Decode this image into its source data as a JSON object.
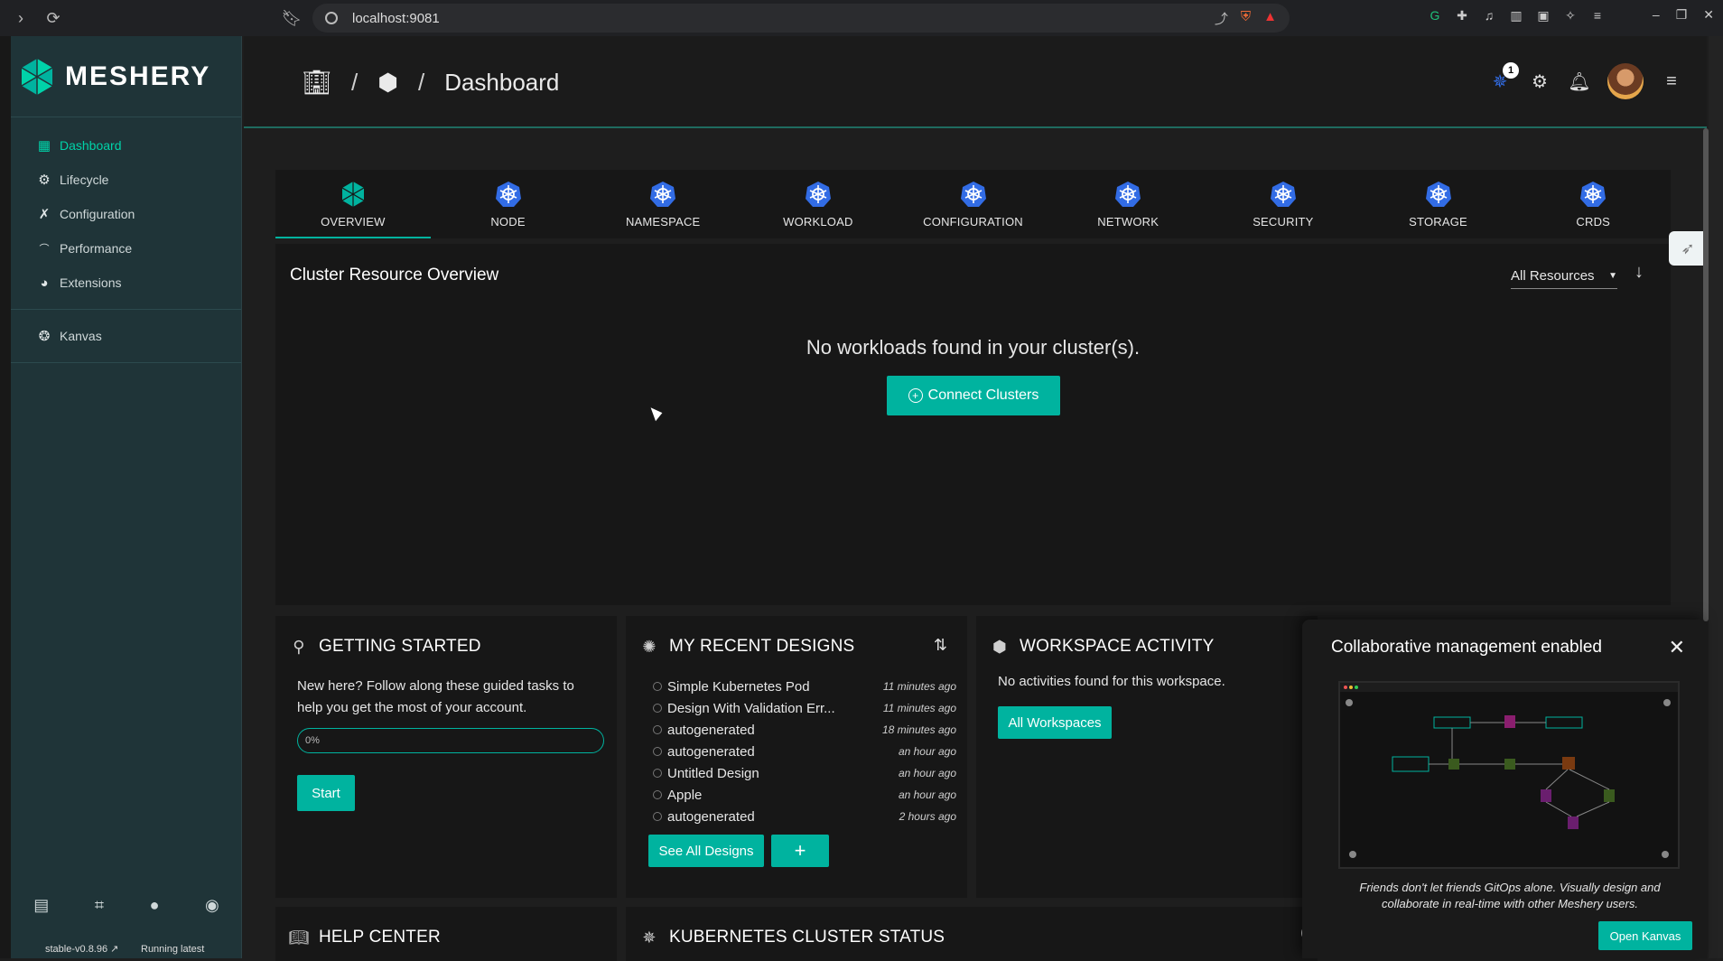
{
  "browser": {
    "url": "localhost:9081"
  },
  "brand": {
    "name": "MESHERY"
  },
  "sidebar": {
    "items": [
      {
        "label": "Dashboard",
        "icon": "dashboard-icon"
      },
      {
        "label": "Lifecycle",
        "icon": "lifecycle-icon"
      },
      {
        "label": "Configuration",
        "icon": "configuration-icon"
      },
      {
        "label": "Performance",
        "icon": "performance-icon"
      },
      {
        "label": "Extensions",
        "icon": "extensions-icon"
      }
    ],
    "secondary": [
      {
        "label": "Kanvas",
        "icon": "kanvas-icon"
      }
    ],
    "version": "stable-v0.8.96",
    "running": "Running latest"
  },
  "header": {
    "crumb_title": "Dashboard",
    "notifications_badge": "1"
  },
  "tabs": [
    {
      "label": "OVERVIEW"
    },
    {
      "label": "NODE"
    },
    {
      "label": "NAMESPACE"
    },
    {
      "label": "WORKLOAD"
    },
    {
      "label": "CONFIGURATION"
    },
    {
      "label": "NETWORK"
    },
    {
      "label": "SECURITY"
    },
    {
      "label": "STORAGE"
    },
    {
      "label": "CRDS"
    }
  ],
  "overview": {
    "title": "Cluster Resource Overview",
    "filter": "All Resources",
    "empty": "No workloads found in your cluster(s).",
    "connect_label": "Connect Clusters"
  },
  "getting_started": {
    "title": "GETTING STARTED",
    "text": "New here? Follow along these guided tasks to help you get the most of your account.",
    "progress_text": "0%",
    "progress": 0,
    "start_label": "Start"
  },
  "recent_designs": {
    "title": "MY RECENT DESIGNS",
    "items": [
      {
        "name": "Simple Kubernetes Pod",
        "when": "11 minutes ago"
      },
      {
        "name": "Design With Validation Err...",
        "when": "11 minutes ago"
      },
      {
        "name": "autogenerated",
        "when": "18 minutes ago"
      },
      {
        "name": "autogenerated",
        "when": "an hour ago"
      },
      {
        "name": "Untitled Design",
        "when": "an hour ago"
      },
      {
        "name": "Apple",
        "when": "an hour ago"
      },
      {
        "name": "autogenerated",
        "when": "2 hours ago"
      }
    ],
    "see_all_label": "See All Designs",
    "add_label": "+"
  },
  "workspace_activity": {
    "title": "WORKSPACE ACTIVITY",
    "text": "No activities found for this workspace.",
    "button_label": "All Workspaces"
  },
  "help_center": {
    "title": "HELP CENTER"
  },
  "k8s_status": {
    "title": "KUBERNETES CLUSTER STATUS"
  },
  "popover": {
    "title": "Collaborative management enabled",
    "text": "Friends don't let friends GitOps alone. Visually design and collaborate in real-time with other Meshery users.",
    "button_label": "Open Kanvas"
  },
  "colors": {
    "accent": "#00b39f",
    "sidebar_bg": "#1f3438",
    "active_nav": "#00d3a9"
  }
}
